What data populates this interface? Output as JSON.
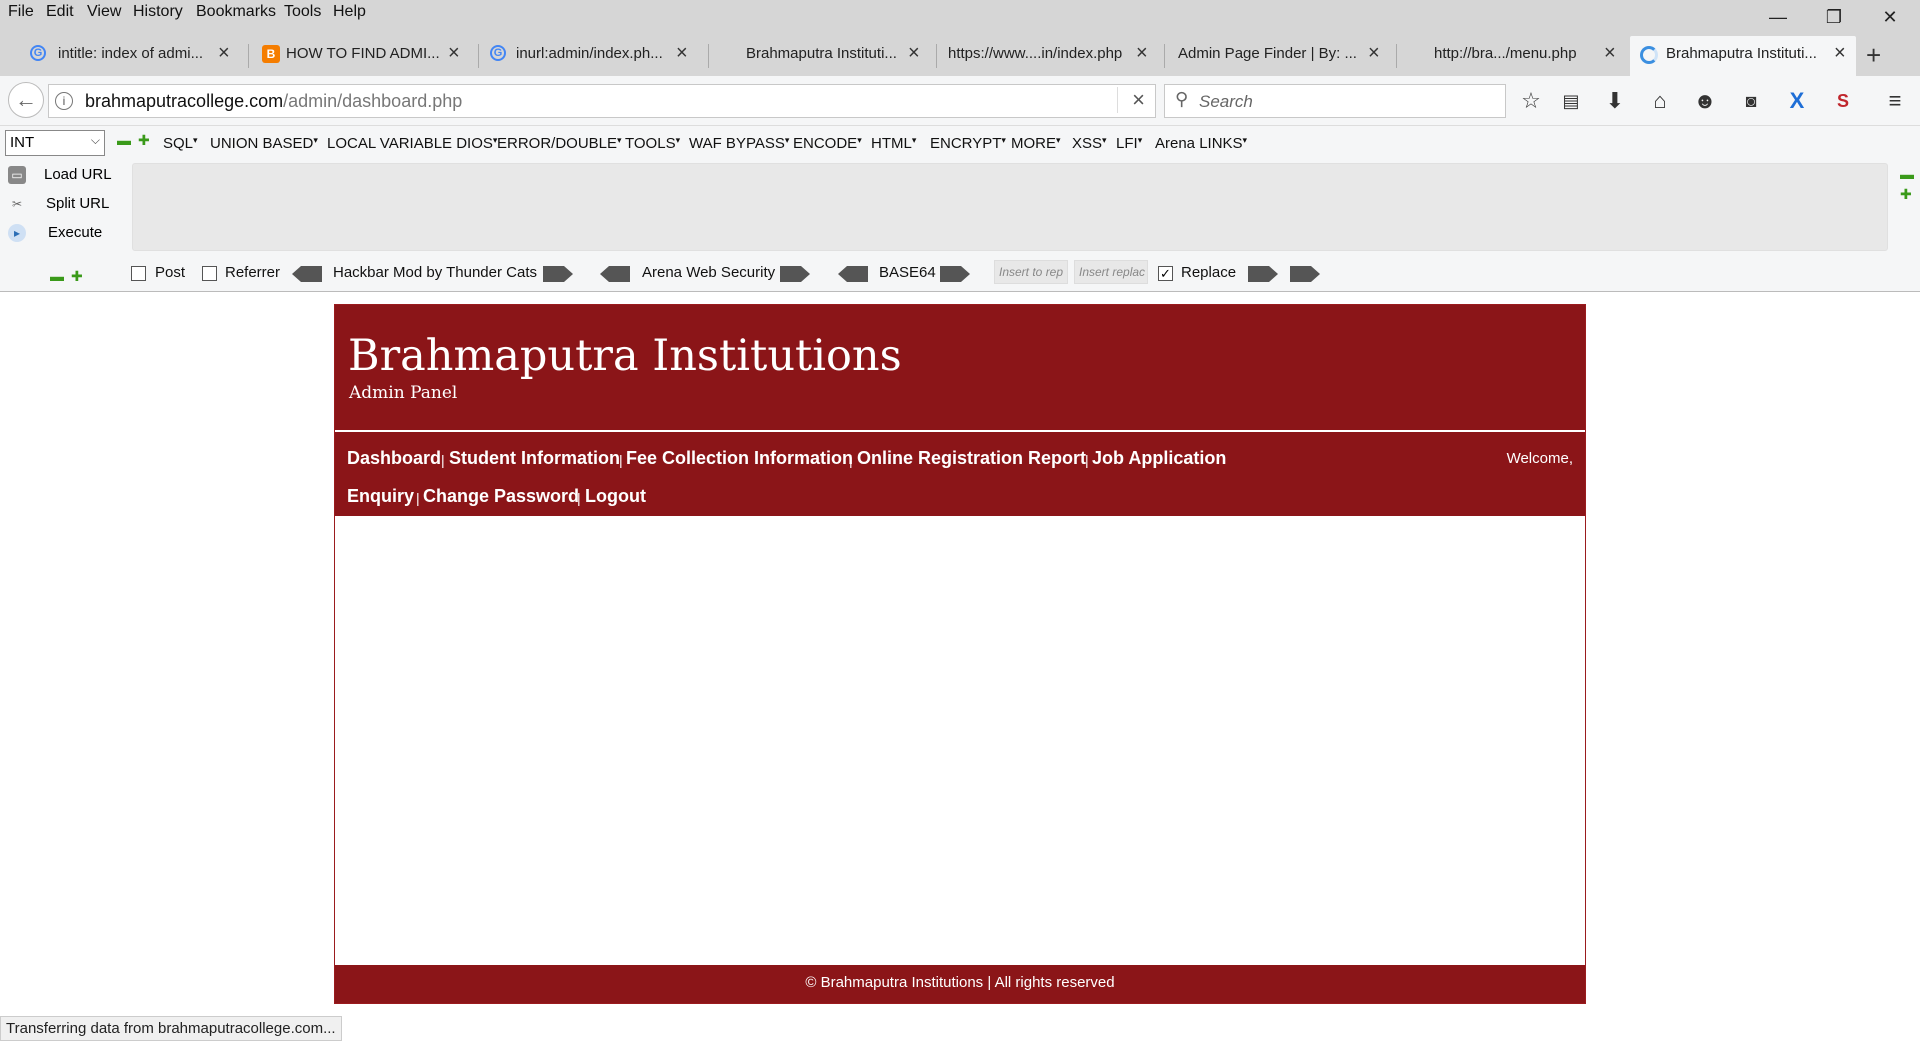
{
  "menu": [
    "File",
    "Edit",
    "View",
    "History",
    "Bookmarks",
    "Tools",
    "Help"
  ],
  "window_controls": {
    "minimize": "—",
    "restore": "❐",
    "close": "✕"
  },
  "tabs": [
    {
      "label": "intitle: index of admi...",
      "favicon": "google-icon"
    },
    {
      "label": "HOW TO FIND ADMI...",
      "favicon": "blogger-icon"
    },
    {
      "label": "inurl:admin/index.ph...",
      "favicon": "google-icon"
    },
    {
      "label": "Brahmaputra Instituti...",
      "favicon": ""
    },
    {
      "label": "https://www....in/index.php",
      "favicon": ""
    },
    {
      "label": "Admin Page Finder | By: ...",
      "favicon": ""
    },
    {
      "label": "http://bra.../menu.php",
      "favicon": ""
    },
    {
      "label": "Brahmaputra Instituti...",
      "favicon": "loading-icon",
      "active": true
    }
  ],
  "url": {
    "host": "brahmaputracollege.com",
    "path": "/admin/dashboard.php"
  },
  "search": {
    "placeholder": "Search"
  },
  "hackbar": {
    "select_value": "INT",
    "menus": [
      "SQL",
      "UNION BASED",
      "LOCAL VARIABLE DIOS",
      "ERROR/DOUBLE",
      "TOOLS",
      "WAF BYPASS",
      "ENCODE",
      "HTML",
      "ENCRYPT",
      "MORE",
      "XSS",
      "LFI",
      "Arena LINKS"
    ],
    "load_url": "Load URL",
    "split_url": "Split URL",
    "execute": "Execute",
    "post": "Post",
    "referrer": "Referrer",
    "mod_label": "Hackbar Mod by Thunder Cats",
    "arena_label": "Arena Web Security",
    "base64_label": "BASE64",
    "insert_to_replace": "Insert to rep",
    "insert_replace": "Insert replac",
    "replace": "Replace"
  },
  "site": {
    "title": "Brahmaputra Institutions",
    "subtitle": "Admin Panel",
    "nav_row1": [
      "Dashboard",
      "Student Information",
      "Fee Collection Information",
      "Online Registration Report",
      "Job Application"
    ],
    "nav_row2": [
      "Enquiry",
      "Change Password",
      "Logout"
    ],
    "separator": "|",
    "welcome": "Welcome,",
    "footer": "© Brahmaputra Institutions | All rights reserved"
  },
  "status": "Transferring data from brahmaputracollege.com..."
}
